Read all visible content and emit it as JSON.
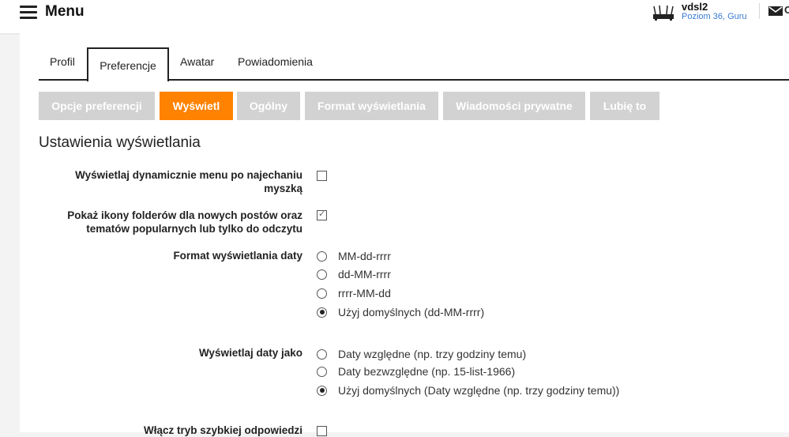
{
  "header": {
    "menu_label": "Menu",
    "user": {
      "name": "vdsl2",
      "rank": "Poziom 36, Guru"
    },
    "mail_partial": "C"
  },
  "tabs": [
    {
      "label": "Profil",
      "active": false
    },
    {
      "label": "Preferencje",
      "active": true
    },
    {
      "label": "Awatar",
      "active": false
    },
    {
      "label": "Powiadomienia",
      "active": false
    }
  ],
  "subtabs": [
    {
      "label": "Opcje preferencji",
      "active": false
    },
    {
      "label": "Wyświetl",
      "active": true
    },
    {
      "label": "Ogólny",
      "active": false
    },
    {
      "label": "Format wyświetlania",
      "active": false
    },
    {
      "label": "Wiadomości prywatne",
      "active": false
    },
    {
      "label": "Lubię to",
      "active": false
    }
  ],
  "section_title": "Ustawienia wyświetlania",
  "settings": {
    "dynamic_menu": {
      "label_line1": "Wyświetlaj dynamicznie menu po najechaniu",
      "label_line2": "myszką",
      "checked": false
    },
    "folder_icons": {
      "label_line1": "Pokaż ikony folderów dla nowych postów oraz",
      "label_line2": "tematów popularnych lub tylko do odczytu",
      "checked": true
    },
    "date_format": {
      "label": "Format wyświetlania daty",
      "options": [
        {
          "text": "MM-dd-rrrr",
          "checked": false
        },
        {
          "text": "dd-MM-rrrr",
          "checked": false
        },
        {
          "text": "rrrr-MM-dd",
          "checked": false
        },
        {
          "text": "Użyj domyślnych (dd-MM-rrrr)",
          "checked": true
        }
      ]
    },
    "date_display": {
      "label": "Wyświetlaj daty jako",
      "options": [
        {
          "text": "Daty względne (np. trzy godziny temu)",
          "checked": false
        },
        {
          "text": "Daty bezwzględne (np. 15-list-1966)",
          "checked": false
        },
        {
          "text": "Użyj domyślnych (Daty względne (np. trzy godziny temu))",
          "checked": true
        }
      ]
    },
    "quick_reply": {
      "label": "Włącz tryb szybkiej odpowiedzi",
      "checked": false
    }
  },
  "colors": {
    "accent": "#ff8200",
    "subtab_inactive": "#d2d2d2",
    "link": "#3a7bd5"
  }
}
